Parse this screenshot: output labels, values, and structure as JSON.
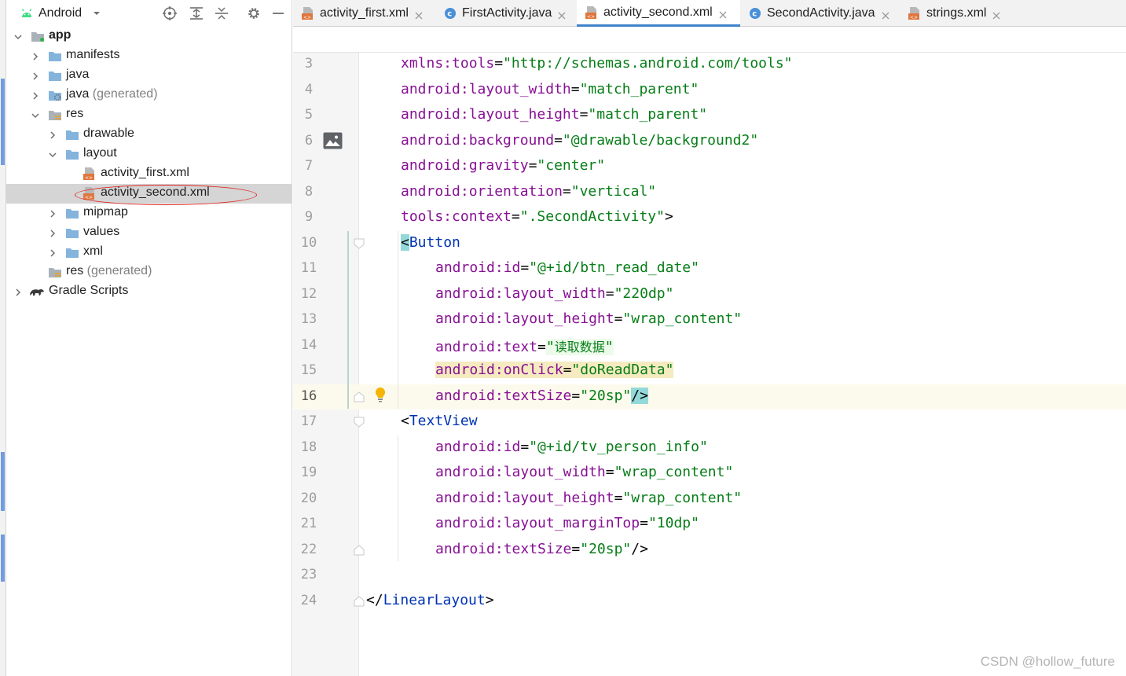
{
  "project_panel": {
    "view_selector": "Android",
    "toolbar_buttons": [
      "locate-icon",
      "expand-all-icon",
      "collapse-all-icon",
      "gear-icon",
      "minimize-icon"
    ],
    "tree": [
      {
        "label": "app",
        "suffix": "",
        "icon": "module-folder-icon",
        "bold": true,
        "expanded": true
      },
      {
        "label": "manifests",
        "suffix": "",
        "icon": "folder-icon",
        "expanded": false
      },
      {
        "label": "java",
        "suffix": "",
        "icon": "folder-icon",
        "expanded": false
      },
      {
        "label": "java",
        "suffix": " (generated)",
        "icon": "generated-folder-icon",
        "expanded": false
      },
      {
        "label": "res",
        "suffix": "",
        "icon": "res-folder-icon",
        "expanded": true
      },
      {
        "label": "drawable",
        "suffix": "",
        "icon": "folder-icon",
        "expanded": false
      },
      {
        "label": "layout",
        "suffix": "",
        "icon": "folder-icon",
        "expanded": true
      },
      {
        "label": "activity_first.xml",
        "suffix": "",
        "icon": "xml-file-icon"
      },
      {
        "label": "activity_second.xml",
        "suffix": "",
        "icon": "xml-file-icon",
        "selected": true
      },
      {
        "label": "mipmap",
        "suffix": "",
        "icon": "folder-icon",
        "expanded": false
      },
      {
        "label": "values",
        "suffix": "",
        "icon": "folder-icon",
        "expanded": false
      },
      {
        "label": "xml",
        "suffix": "",
        "icon": "folder-icon",
        "expanded": false
      },
      {
        "label": "res",
        "suffix": " (generated)",
        "icon": "res-folder-icon"
      },
      {
        "label": "Gradle Scripts",
        "suffix": "",
        "icon": "gradle-icon",
        "expanded": false
      }
    ]
  },
  "tabs": [
    {
      "label": "activity_first.xml",
      "icon": "xml-file-icon",
      "active": false
    },
    {
      "label": "FirstActivity.java",
      "icon": "java-class-icon",
      "active": false
    },
    {
      "label": "activity_second.xml",
      "icon": "xml-file-icon",
      "active": true
    },
    {
      "label": "SecondActivity.java",
      "icon": "java-class-icon",
      "active": false
    },
    {
      "label": "strings.xml",
      "icon": "xml-file-icon",
      "active": false
    }
  ],
  "editor": {
    "current_line": 16,
    "lines": [
      {
        "num": "3"
      },
      {
        "num": "4"
      },
      {
        "num": "5"
      },
      {
        "num": "6"
      },
      {
        "num": "7"
      },
      {
        "num": "8"
      },
      {
        "num": "9"
      },
      {
        "num": "10"
      },
      {
        "num": "11"
      },
      {
        "num": "12"
      },
      {
        "num": "13"
      },
      {
        "num": "14"
      },
      {
        "num": "15"
      },
      {
        "num": "16"
      },
      {
        "num": "17"
      },
      {
        "num": "18"
      },
      {
        "num": "19"
      },
      {
        "num": "20"
      },
      {
        "num": "21"
      },
      {
        "num": "22"
      },
      {
        "num": "23"
      },
      {
        "num": "24"
      }
    ],
    "code": {
      "l3": {
        "attr": "xmlns:tools",
        "val": "\"http://schemas.android.com/tools\""
      },
      "l4": {
        "attr": "android:layout_width",
        "val": "\"match_parent\""
      },
      "l5": {
        "attr": "android:layout_height",
        "val": "\"match_parent\""
      },
      "l6": {
        "attr": "android:background",
        "val": "\"@drawable/background2\""
      },
      "l7": {
        "attr": "android:gravity",
        "val": "\"center\""
      },
      "l8": {
        "attr": "android:orientation",
        "val": "\"vertical\""
      },
      "l9": {
        "attr": "tools:context",
        "val": "\".SecondActivity\"",
        "close": ">"
      },
      "l10": {
        "open": "<",
        "tag": "Button"
      },
      "l11": {
        "attr": "android:id",
        "val": "\"@+id/btn_read_date\""
      },
      "l12": {
        "attr": "android:layout_width",
        "val": "\"220dp\""
      },
      "l13": {
        "attr": "android:layout_height",
        "val": "\"wrap_content\""
      },
      "l14": {
        "attr": "android:text",
        "val_open": "\"",
        "val_text": "读取数据",
        "val_close": "\""
      },
      "l15": {
        "attr": "android:onClick",
        "val": "\"doReadData\""
      },
      "l16": {
        "attr": "android:textSize",
        "val": "\"20sp\"",
        "close": "/>"
      },
      "l17": {
        "open": "<",
        "tag": "TextView"
      },
      "l18": {
        "attr": "android:id",
        "val": "\"@+id/tv_person_info\""
      },
      "l19": {
        "attr": "android:layout_width",
        "val": "\"wrap_content\""
      },
      "l20": {
        "attr": "android:layout_height",
        "val": "\"wrap_content\""
      },
      "l21": {
        "attr": "android:layout_marginTop",
        "val": "\"10dp\""
      },
      "l22": {
        "attr": "android:textSize",
        "val": "\"20sp\"",
        "close": "/>"
      },
      "l24": {
        "open": "</",
        "tag": "LinearLayout",
        "close": ">"
      }
    },
    "eq": "="
  },
  "watermark": "CSDN @hollow_future",
  "colors": {
    "attr": "#871094",
    "value": "#067d17",
    "tag": "#0033b3",
    "selection": "#d5d5d5",
    "annotation": "#e0231f"
  }
}
